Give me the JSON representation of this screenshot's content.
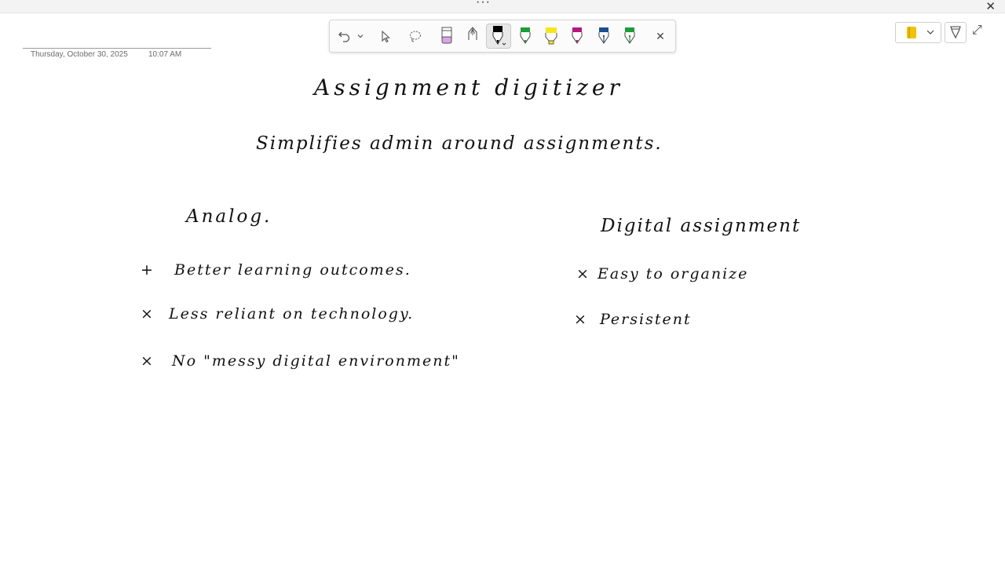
{
  "window": {
    "more_glyph": "···",
    "close_glyph": "✕"
  },
  "toolbar": {
    "tools": [
      {
        "name": "undo-icon"
      },
      {
        "name": "undo-dropdown-icon"
      },
      {
        "name": "select-pointer-icon"
      },
      {
        "name": "lasso-icon"
      },
      {
        "name": "eraser-icon"
      },
      {
        "name": "ballpoint-pen-icon"
      },
      {
        "name": "black-pen-icon",
        "color": "#000000",
        "selected": true
      },
      {
        "name": "green-pen-icon",
        "color": "#1e9b3c"
      },
      {
        "name": "yellow-highlighter-icon",
        "color": "#f5e61e"
      },
      {
        "name": "magenta-pen-icon",
        "color": "#b4177f"
      },
      {
        "name": "blue-fountain-pen-icon",
        "color": "#1b4f8a"
      },
      {
        "name": "green-fountain-pen-icon",
        "color": "#1e9b3c"
      },
      {
        "name": "close-icon"
      }
    ],
    "close_glyph": "✕"
  },
  "right_tools": {
    "notebook_color": "#f2c200",
    "expand_glyph": "⤢"
  },
  "page": {
    "date": "Thursday, October 30, 2025",
    "time": "10:07 AM"
  },
  "ink": {
    "title": "Assignment digitizer",
    "subtitle": "Simplifies admin around assignments.",
    "left_heading": "Analog.",
    "left_items": [
      {
        "bullet": "+",
        "text": "Better learning outcomes."
      },
      {
        "bullet": "×",
        "text": "Less reliant on technology."
      },
      {
        "bullet": "×",
        "text": "No \"messy digital environment\""
      }
    ],
    "right_heading": "Digital assignment",
    "right_items": [
      {
        "bullet": "×",
        "text": "Easy to organize"
      },
      {
        "bullet": "×",
        "text": "Persistent"
      }
    ]
  }
}
